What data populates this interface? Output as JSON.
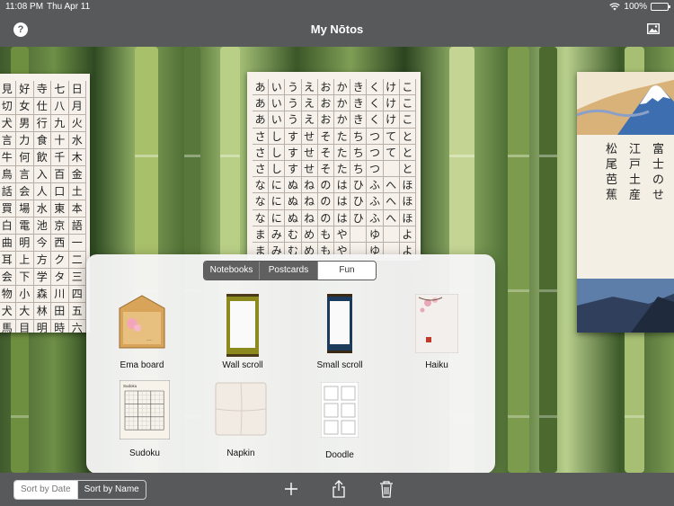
{
  "status": {
    "time": "11:08 PM",
    "date": "Thu Apr 11",
    "battery": "100%",
    "battery_level": 1.0
  },
  "nav": {
    "title": "My Nōtos",
    "help_icon": "question-circle-icon",
    "photo_icon": "photo-icon"
  },
  "cards": {
    "kanji_columns": [
      [
        "日",
        "月",
        "火",
        "水",
        "木",
        "金",
        "土",
        "本",
        "語",
        "一",
        "二",
        "三",
        "四",
        "五",
        "六"
      ],
      [
        "七",
        "八",
        "九",
        "十",
        "千",
        "百",
        "口",
        "東",
        "京",
        "西",
        "ク",
        "タ",
        "川",
        "田",
        "時"
      ],
      [
        "寺",
        "仕",
        "行",
        "食",
        "飲",
        "入",
        "人",
        "水",
        "池",
        "今",
        "方",
        "学",
        "森",
        "林",
        "明"
      ],
      [
        "好",
        "女",
        "男",
        "力",
        "何",
        "言",
        "会",
        "場",
        "電",
        "明",
        "上",
        "下",
        "小",
        "大",
        "目"
      ],
      [
        "見",
        "切",
        "犬",
        "言",
        "牛",
        "鳥",
        "話",
        "買",
        "白",
        "曲",
        "耳",
        "会",
        "物",
        "犬",
        "馬"
      ]
    ],
    "kana_rows": [
      [
        "あ",
        "い",
        "う",
        "え",
        "お",
        "か",
        "き",
        "く",
        "け",
        "こ"
      ],
      [
        "あ",
        "い",
        "う",
        "え",
        "お",
        "か",
        "き",
        "く",
        "け",
        "こ"
      ],
      [
        "あ",
        "い",
        "う",
        "え",
        "お",
        "か",
        "き",
        "く",
        "け",
        "こ"
      ],
      [
        "さ",
        "し",
        "す",
        "せ",
        "そ",
        "た",
        "ち",
        "つ",
        "て",
        "と"
      ],
      [
        "さ",
        "し",
        "す",
        "せ",
        "そ",
        "た",
        "ち",
        "つ",
        "て",
        "と"
      ],
      [
        "さ",
        "し",
        "す",
        "せ",
        "そ",
        "た",
        "ち",
        "つ",
        "",
        "と"
      ],
      [
        "な",
        "に",
        "ぬ",
        "ね",
        "の",
        "は",
        "ひ",
        "ふ",
        "へ",
        "ほ"
      ],
      [
        "な",
        "に",
        "ぬ",
        "ね",
        "の",
        "は",
        "ひ",
        "ふ",
        "へ",
        "ほ"
      ],
      [
        "な",
        "に",
        "ぬ",
        "ね",
        "の",
        "は",
        "ひ",
        "ふ",
        "へ",
        "ほ"
      ],
      [
        "ま",
        "み",
        "む",
        "め",
        "も",
        "や",
        "",
        "ゆ",
        "",
        "よ"
      ],
      [
        "ま",
        "み",
        "む",
        "め",
        "も",
        "や",
        "",
        "ゆ",
        "",
        "よ"
      ]
    ],
    "poem_columns": [
      "松尾芭蕉",
      "江戸土産",
      "富士のせ"
    ]
  },
  "popover": {
    "tabs": [
      {
        "label": "Notebooks",
        "active": false
      },
      {
        "label": "Postcards",
        "active": false
      },
      {
        "label": "Fun",
        "active": true
      }
    ],
    "items": [
      {
        "label": "Ema board",
        "icon": "ema-board-icon"
      },
      {
        "label": "Wall scroll",
        "icon": "wall-scroll-icon"
      },
      {
        "label": "Small scroll",
        "icon": "small-scroll-icon"
      },
      {
        "label": "Haiku",
        "icon": "haiku-icon"
      },
      {
        "label": "Sudoku",
        "icon": "sudoku-icon"
      },
      {
        "label": "Napkin",
        "icon": "napkin-icon"
      },
      {
        "label": "Doodle",
        "icon": "doodle-icon"
      }
    ],
    "sudoku_header": "Sudoku"
  },
  "toolbar": {
    "sort_date": "Sort by Date",
    "sort_name": "Sort by Name",
    "sort_active": "date",
    "icons": [
      "plus-icon",
      "share-icon",
      "trash-icon"
    ]
  },
  "colors": {
    "chrome": "#58595b",
    "popover": "#f5f5f5",
    "segment_dark": "#606060"
  }
}
